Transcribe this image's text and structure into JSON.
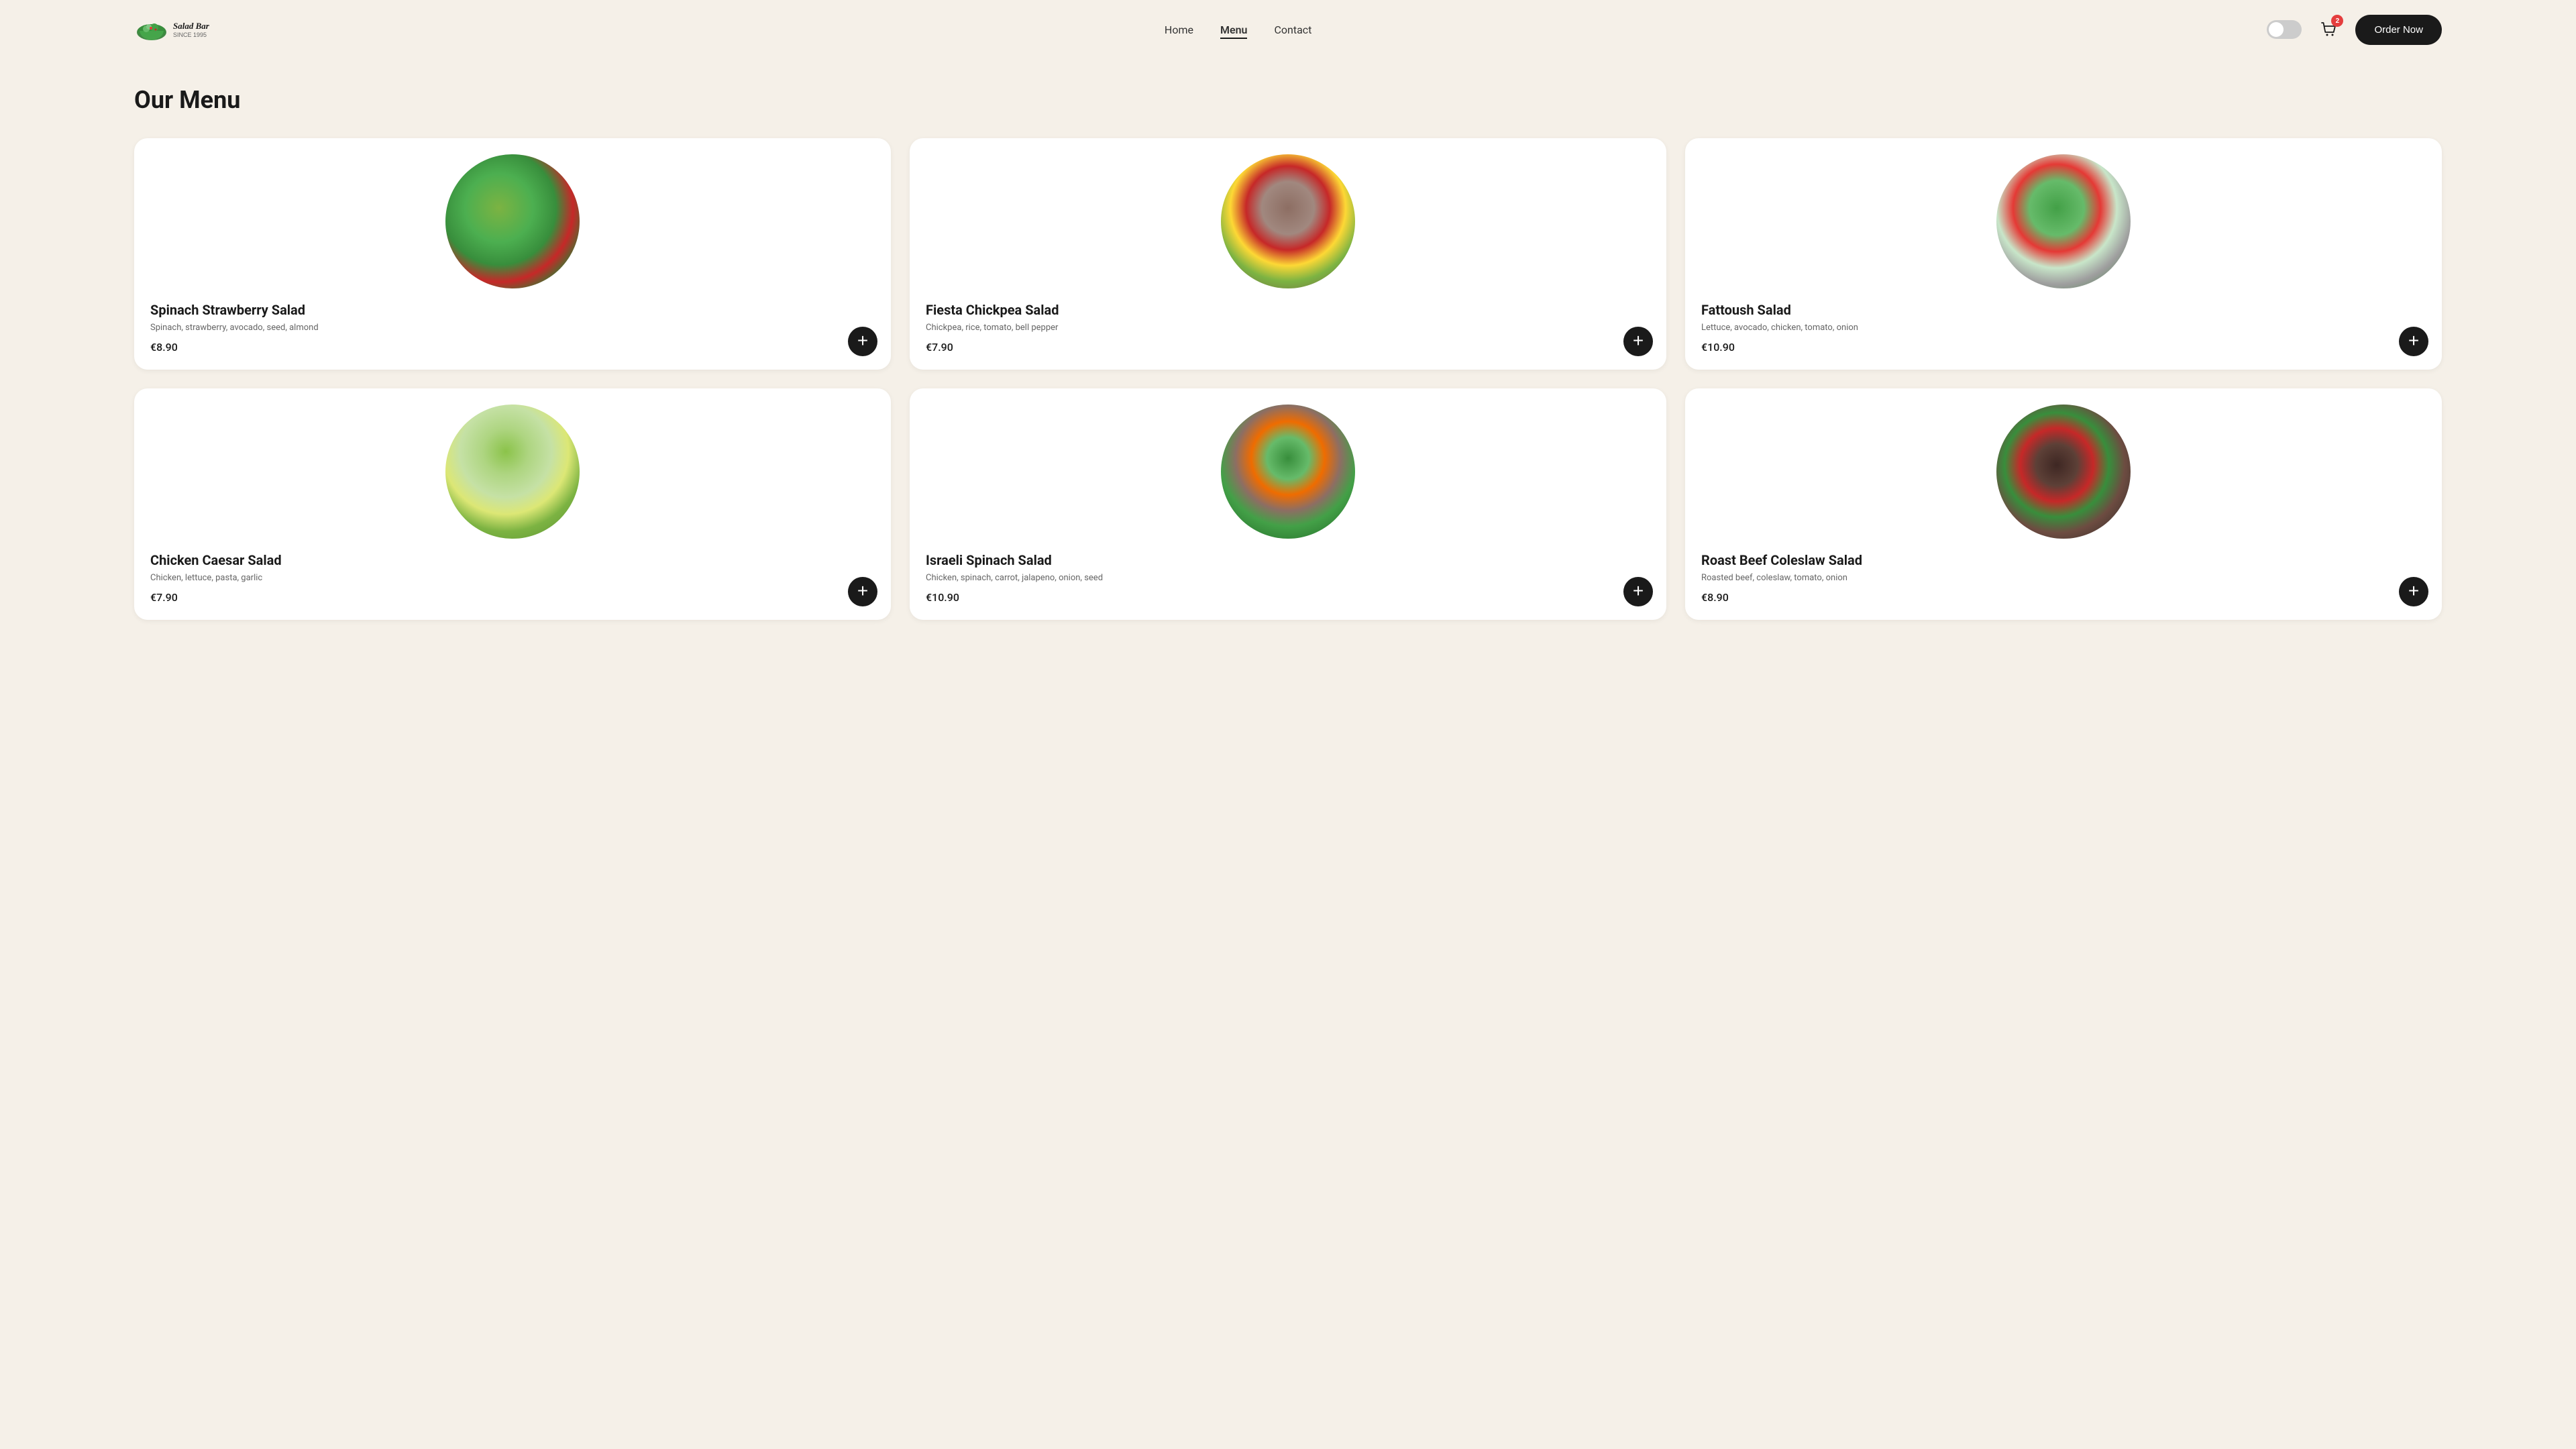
{
  "header": {
    "logo_text": "Salad Bar",
    "logo_since": "SINCE 1995",
    "nav": [
      {
        "label": "Home",
        "active": false
      },
      {
        "label": "Menu",
        "active": true
      },
      {
        "label": "Contact",
        "active": false
      }
    ],
    "cart_count": "2",
    "order_button": "Order Now"
  },
  "main": {
    "page_title": "Our Menu",
    "menu_items": [
      {
        "id": "spinach-strawberry",
        "name": "Spinach Strawberry Salad",
        "ingredients": "Spinach, strawberry, avocado, seed, almond",
        "price": "€8.90",
        "image_class": "salad-spinach-strawberry"
      },
      {
        "id": "fiesta-chickpea",
        "name": "Fiesta Chickpea Salad",
        "ingredients": "Chickpea, rice, tomato, bell pepper",
        "price": "€7.90",
        "image_class": "salad-fiesta-chickpea"
      },
      {
        "id": "fattoush",
        "name": "Fattoush Salad",
        "ingredients": "Lettuce, avocado, chicken, tomato, onion",
        "price": "€10.90",
        "image_class": "salad-fattoush"
      },
      {
        "id": "chicken-caesar",
        "name": "Chicken Caesar Salad",
        "ingredients": "Chicken, lettuce, pasta, garlic",
        "price": "€7.90",
        "image_class": "salad-chicken-caesar"
      },
      {
        "id": "israeli-spinach",
        "name": "Israeli Spinach Salad",
        "ingredients": "Chicken, spinach, carrot, jalapeno, onion, seed",
        "price": "€10.90",
        "image_class": "salad-israeli-spinach"
      },
      {
        "id": "roast-beef-coleslaw",
        "name": "Roast Beef Coleslaw Salad",
        "ingredients": "Roasted beef, coleslaw, tomato, onion",
        "price": "€8.90",
        "image_class": "salad-roast-beef"
      }
    ]
  }
}
